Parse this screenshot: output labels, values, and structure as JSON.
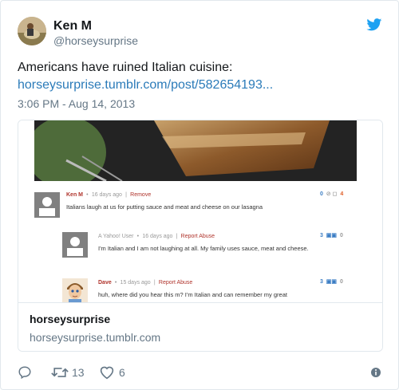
{
  "author": {
    "name": "Ken M",
    "handle": "@horseysurprise"
  },
  "tweet": {
    "text": "Americans have ruined Italian cuisine:",
    "link": "horseysurprise.tumblr.com/post/582654193...",
    "timestamp": "3:06 PM - Aug 14, 2013"
  },
  "card": {
    "title": "horseysurprise",
    "domain": "horseysurprise.tumblr.com",
    "comments": [
      {
        "user": "Ken M",
        "meta": "16 days ago",
        "action": "Remove",
        "text": "Italians laugh at us for putting sauce and meat and cheese on our lasagna",
        "votes_up": "0",
        "votes_down": "4"
      },
      {
        "user": "A Yahoo! User",
        "meta": "16 days ago",
        "action": "Report Abuse",
        "text": "I'm Italian and I am not laughing at all. My family uses sauce, meat and cheese.",
        "votes_up": "3",
        "votes_down": "0"
      },
      {
        "user": "Dave",
        "meta": "15 days ago",
        "action": "Report Abuse",
        "text": "huh, where did you hear this m? I'm Italian and can remember my great",
        "votes_up": "3",
        "votes_down": "0"
      }
    ]
  },
  "actions": {
    "retweets": "13",
    "likes": "6"
  },
  "colors": {
    "link": "#2b7bb9",
    "twitter_blue": "#1da1f2",
    "secondary_text": "#657786"
  },
  "icons": {
    "brand": "twitter-bird-icon",
    "reply": "reply-icon",
    "retweet": "retweet-icon",
    "like": "heart-icon",
    "info": "info-icon"
  }
}
